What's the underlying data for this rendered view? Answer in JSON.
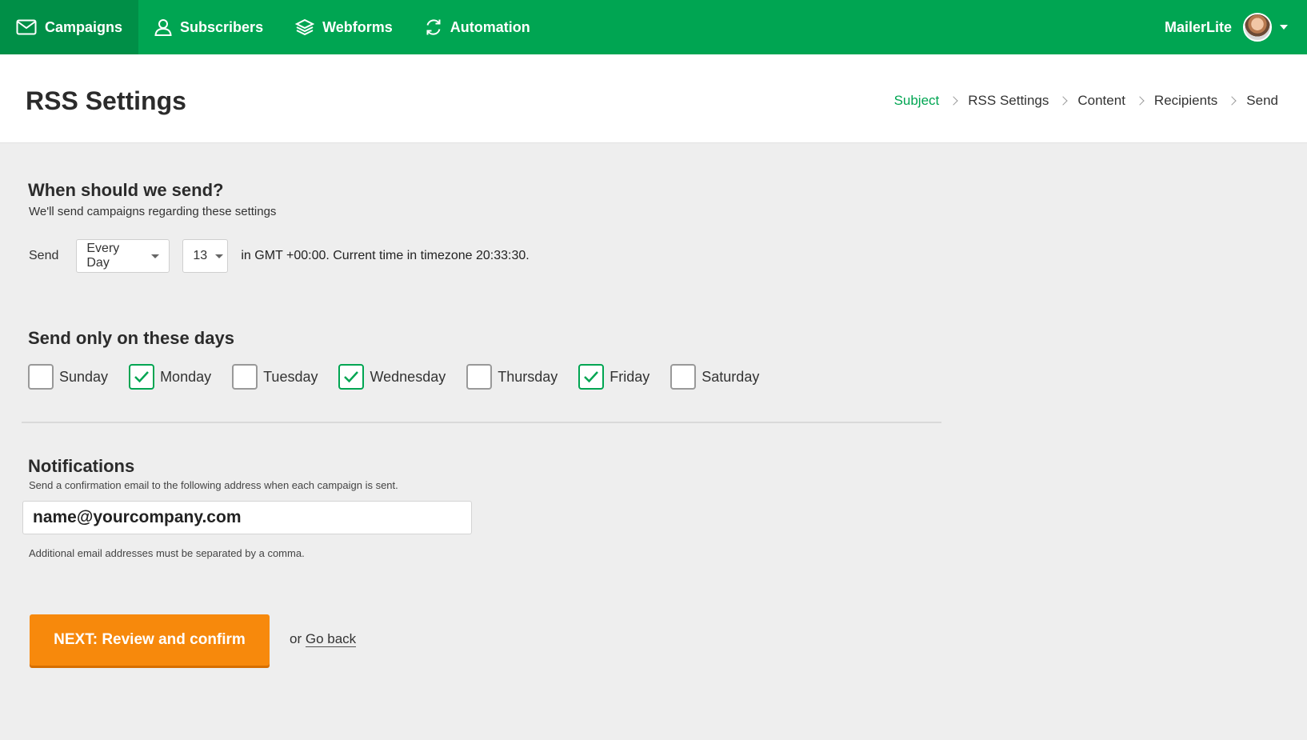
{
  "nav": {
    "items": [
      {
        "label": "Campaigns",
        "icon": "envelope-icon",
        "active": true
      },
      {
        "label": "Subscribers",
        "icon": "user-icon",
        "active": false
      },
      {
        "label": "Webforms",
        "icon": "layers-icon",
        "active": false
      },
      {
        "label": "Automation",
        "icon": "refresh-icon",
        "active": false
      }
    ],
    "account_name": "MailerLite"
  },
  "header": {
    "title": "RSS Settings",
    "breadcrumb": [
      "Subject",
      "RSS Settings",
      "Content",
      "Recipients",
      "Send"
    ]
  },
  "schedule": {
    "heading": "When should we send?",
    "subtext": "We'll send campaigns regarding these settings",
    "send_label": "Send",
    "frequency": "Every Day",
    "hour": "13",
    "timezone_text": "in GMT +00:00. Current time in timezone 20:33:30."
  },
  "days": {
    "heading": "Send only on these days",
    "items": [
      {
        "label": "Sunday",
        "checked": false
      },
      {
        "label": "Monday",
        "checked": true
      },
      {
        "label": "Tuesday",
        "checked": false
      },
      {
        "label": "Wednesday",
        "checked": true
      },
      {
        "label": "Thursday",
        "checked": false
      },
      {
        "label": "Friday",
        "checked": true
      },
      {
        "label": "Saturday",
        "checked": false
      }
    ]
  },
  "notifications": {
    "heading": "Notifications",
    "subtext": "Send a confirmation email to the following address when each campaign is sent.",
    "email_value": "name@yourcompany.com",
    "hint": "Additional email addresses must be separated by a comma."
  },
  "actions": {
    "next_label": "NEXT: Review and confirm",
    "or_text": "or",
    "back_label": "Go back"
  },
  "colors": {
    "brand_green": "#00a552",
    "nav_active": "#008f47",
    "button_orange": "#f7890c"
  }
}
